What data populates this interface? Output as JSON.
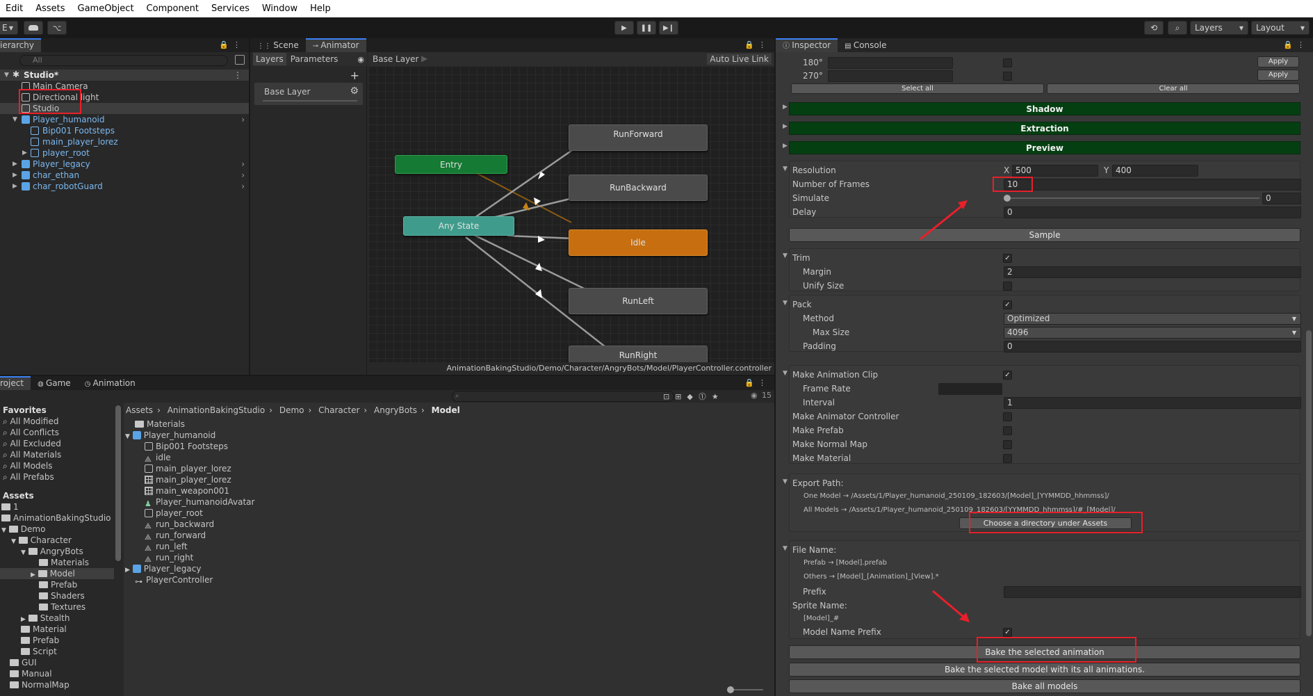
{
  "menu": [
    "Edit",
    "Assets",
    "GameObject",
    "Component",
    "Services",
    "Window",
    "Help"
  ],
  "toolbar": {
    "account_label": "E",
    "layers_label": "Layers",
    "layout_label": "Layout"
  },
  "hierarchy": {
    "tab_label": "ierarchy",
    "search_placeholder": "All",
    "scene_name": "Studio*",
    "items": [
      {
        "label": "Main Camera"
      },
      {
        "label": "Directional light"
      },
      {
        "label": "Studio"
      },
      {
        "label": "Player_humanoid"
      },
      {
        "label": "Bip001 Footsteps"
      },
      {
        "label": "main_player_lorez"
      },
      {
        "label": "player_root"
      },
      {
        "label": "Player_legacy"
      },
      {
        "label": "char_ethan"
      },
      {
        "label": "char_robotGuard"
      }
    ]
  },
  "animator": {
    "tabs": [
      "Scene",
      "Animator"
    ],
    "side_tabs": [
      "Layers",
      "Parameters"
    ],
    "breadcrumb": "Base Layer",
    "auto_live_link": "Auto Live Link",
    "layer_name": "Base Layer",
    "footer_path": "AnimationBakingStudio/Demo/Character/AngryBots/Model/PlayerController.controller",
    "states": {
      "entry": "Entry",
      "any_state": "Any State",
      "idle": "Idle",
      "run_forward": "RunForward",
      "run_backward": "RunBackward",
      "run_left": "RunLeft",
      "run_right": "RunRight"
    }
  },
  "inspector": {
    "tabs": [
      "Inspector",
      "Console"
    ],
    "rot_180": "180°",
    "rot_270": "270°",
    "apply": "Apply",
    "select_all": "Select all",
    "clear_all": "Clear all",
    "sections": {
      "shadow": "Shadow",
      "extraction": "Extraction",
      "preview": "Preview"
    },
    "resolution_label": "Resolution",
    "res_x_label": "X",
    "res_x": "500",
    "res_y_label": "Y",
    "res_y": "400",
    "frames_label": "Number of Frames",
    "frames_value": "10",
    "simulate_label": "Simulate",
    "simulate_value": "0",
    "delay_label": "Delay",
    "delay_value": "0",
    "sample_button": "Sample",
    "trim_label": "Trim",
    "margin_label": "Margin",
    "margin_value": "2",
    "unify_label": "Unify Size",
    "pack_label": "Pack",
    "method_label": "Method",
    "method_value": "Optimized",
    "maxsize_label": "Max Size",
    "maxsize_value": "4096",
    "padding_label": "Padding",
    "padding_value": "0",
    "make_clip_label": "Make Animation Clip",
    "frame_rate_label": "Frame Rate",
    "interval_label": "Interval",
    "interval_value": "1",
    "make_controller_label": "Make Animator Controller",
    "make_prefab_label": "Make Prefab",
    "make_normal_label": "Make Normal Map",
    "make_material_label": "Make Material",
    "export_label": "Export Path:",
    "export_one": "One Model → /Assets/1/Player_humanoid_250109_182603/[Model]_[YYMMDD_hhmmss]/",
    "export_all": "All Models → /Assets/1/Player_humanoid_250109_182603/[YYMMDD_hhmmss]/#_[Model]/",
    "choose_dir_button": "Choose a directory under Assets",
    "file_name_label": "File Name:",
    "file_prefab": "Prefab → [Model].prefab",
    "file_others": "Others → [Model]_[Animation]_[View].*",
    "prefix_label": "Prefix",
    "sprite_name_label": "Sprite Name:",
    "sprite_name_value": "[Model]_#",
    "model_name_prefix_label": "Model Name Prefix",
    "bake_selected_anim": "Bake the selected animation",
    "bake_selected_model": "Bake the selected model with its all animations.",
    "bake_all": "Bake all models"
  },
  "project": {
    "tabs": [
      "roject",
      "Game",
      "Animation"
    ],
    "hidden_count": "15",
    "favorites_label": "Favorites",
    "favorites": [
      "All Modified",
      "All Conflicts",
      "All Excluded",
      "All Materials",
      "All Models",
      "All Prefabs"
    ],
    "assets_label": "Assets",
    "tree": [
      "1",
      "AnimationBakingStudio",
      "Demo",
      "Character",
      "AngryBots",
      "Materials",
      "Model",
      "Prefab",
      "Shaders",
      "Textures",
      "Stealth",
      "Material",
      "Prefab",
      "Script",
      "GUI",
      "Manual",
      "NormalMap"
    ],
    "breadcrumb": [
      "Assets",
      "AnimationBakingStudio",
      "Demo",
      "Character",
      "AngryBots",
      "Model"
    ],
    "items": [
      "Materials",
      "Player_humanoid",
      "Bip001 Footsteps",
      "idle",
      "main_player_lorez",
      "main_player_lorez",
      "main_weapon001",
      "Player_humanoidAvatar",
      "player_root",
      "run_backward",
      "run_forward",
      "run_left",
      "run_right",
      "Player_legacy",
      "PlayerController"
    ]
  }
}
